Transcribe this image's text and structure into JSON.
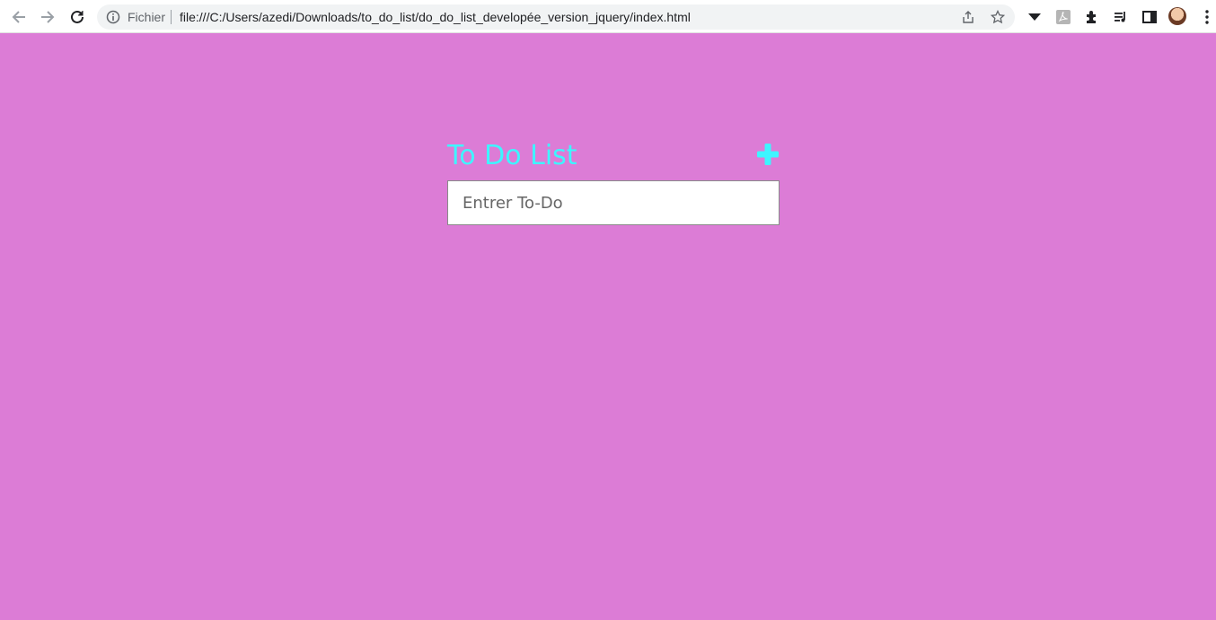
{
  "browser": {
    "scheme_label": "Fichier",
    "url": "file:///C:/Users/azedi/Downloads/to_do_list/do_do_list_developée_version_jquery/index.html"
  },
  "app": {
    "title": "To Do List",
    "input": {
      "value": "",
      "placeholder": "Entrer To-Do"
    },
    "add_icon": "plus-icon"
  },
  "colors": {
    "page_background": "#dc7cd6",
    "accent": "#3ef5ff",
    "input_background": "#ffffff"
  }
}
